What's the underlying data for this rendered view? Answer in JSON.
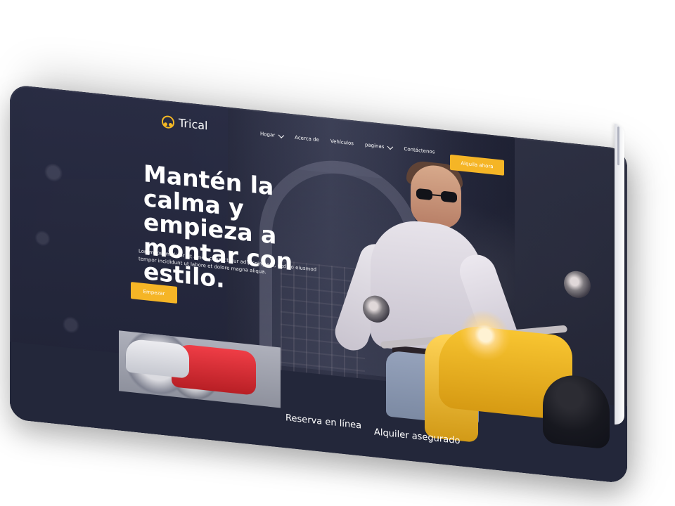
{
  "brand": {
    "name": "Trical"
  },
  "nav": {
    "items": [
      {
        "label": "Hogar"
      },
      {
        "label": "Acerca de"
      },
      {
        "label": "Vehículos"
      },
      {
        "label": "paginas"
      },
      {
        "label": "Contáctenos"
      }
    ]
  },
  "cta": {
    "rent_now": "Alquila ahora",
    "start": "Empezar"
  },
  "hero": {
    "headline": "Mantén la calma y empieza a montar con estilo.",
    "subcopy": "Lorem ipsum dolor sit amet, consectetur adipiscing elit, sed do eiusmod tempor incididunt ut labore et dolore magna aliqua."
  },
  "features": [
    {
      "title": "Reserva en línea"
    },
    {
      "title": "Alquiler asegurado"
    }
  ]
}
